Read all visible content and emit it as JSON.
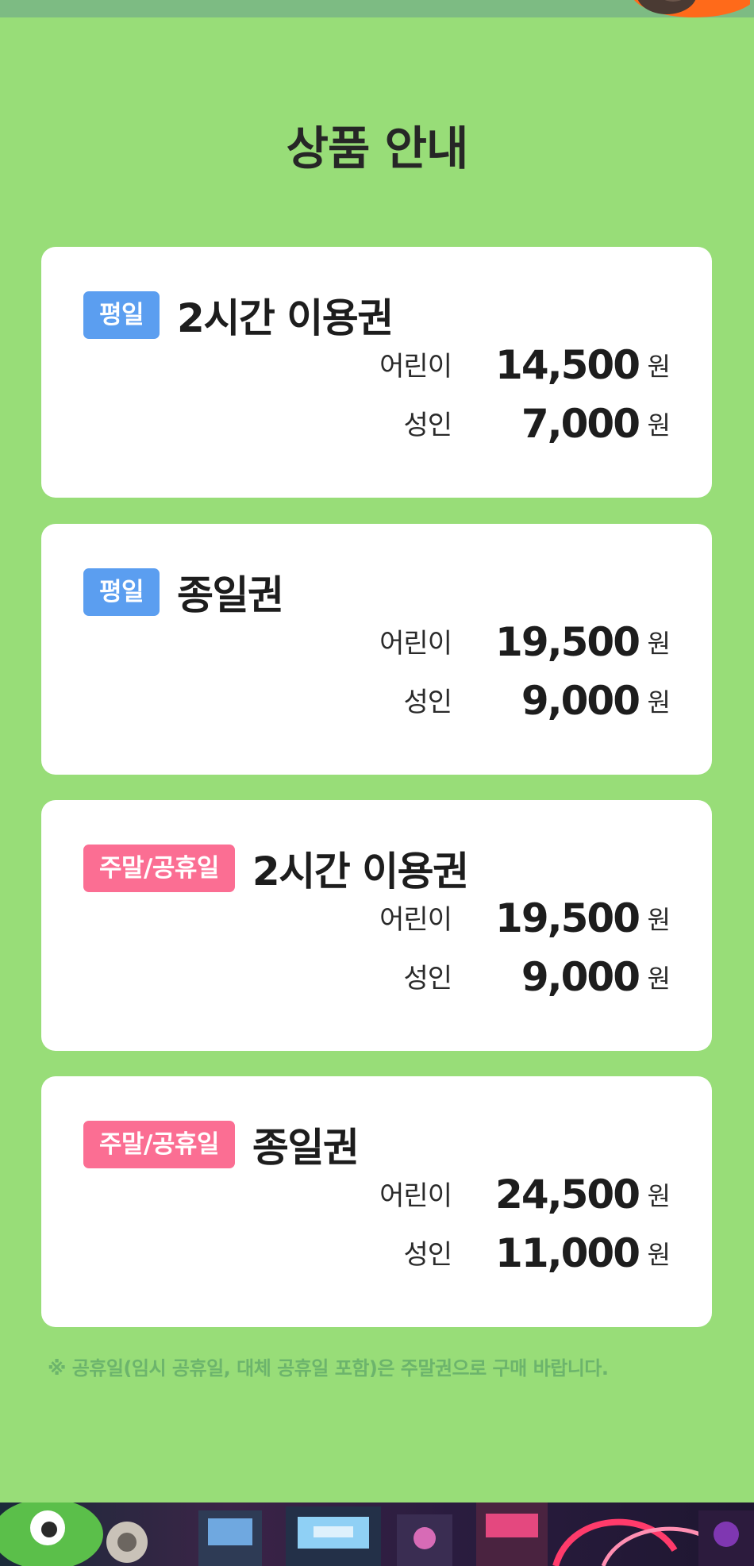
{
  "section": {
    "title": "상품 안내"
  },
  "cards": [
    {
      "tag": "평일",
      "tag_type": "weekday",
      "title": "2시간 이용권",
      "prices": [
        {
          "label": "어린이",
          "amount": "14,500",
          "unit": "원"
        },
        {
          "label": "성인",
          "amount": "7,000",
          "unit": "원"
        }
      ]
    },
    {
      "tag": "평일",
      "tag_type": "weekday",
      "title": "종일권",
      "prices": [
        {
          "label": "어린이",
          "amount": "19,500",
          "unit": "원"
        },
        {
          "label": "성인",
          "amount": "9,000",
          "unit": "원"
        }
      ]
    },
    {
      "tag": "주말/공휴일",
      "tag_type": "weekend",
      "title": "2시간 이용권",
      "prices": [
        {
          "label": "어린이",
          "amount": "19,500",
          "unit": "원"
        },
        {
          "label": "성인",
          "amount": "9,000",
          "unit": "원"
        }
      ]
    },
    {
      "tag": "주말/공휴일",
      "tag_type": "weekend",
      "title": "종일권",
      "prices": [
        {
          "label": "어린이",
          "amount": "24,500",
          "unit": "원"
        },
        {
          "label": "성인",
          "amount": "11,000",
          "unit": "원"
        }
      ]
    }
  ],
  "notice": "※ 공휴일(임시 공휴일, 대체 공휴일 포함)은 주말권으로 구매 바랍니다.",
  "colors": {
    "background": "#98dd78",
    "weekday_tag": "#5b9ef0",
    "weekend_tag": "#fb6e93",
    "notice_text": "#6cb46c"
  }
}
